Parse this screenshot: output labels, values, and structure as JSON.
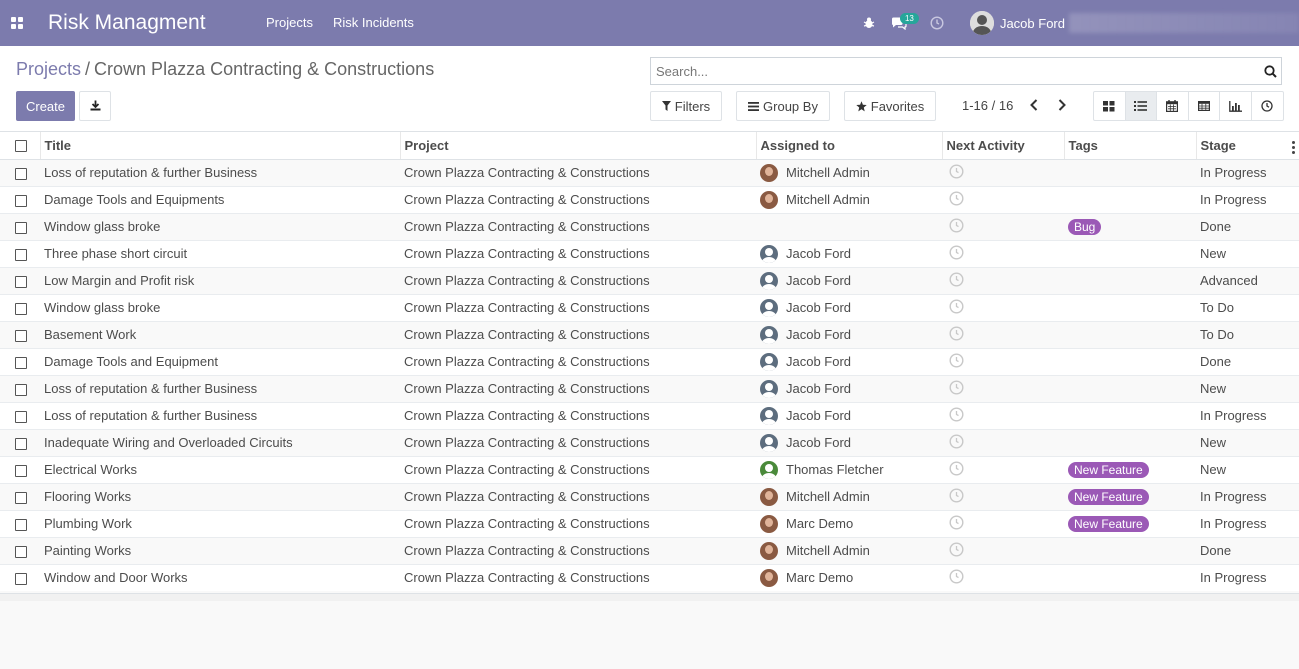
{
  "app": {
    "title": "Risk Managment",
    "menu": [
      "Projects",
      "Risk Incidents"
    ],
    "message_count": "13",
    "user_name": "Jacob Ford"
  },
  "breadcrumb": {
    "parent": "Projects",
    "separator": "/",
    "current": "Crown Plazza Contracting & Constructions"
  },
  "search": {
    "placeholder": "Search..."
  },
  "buttons": {
    "create": "Create",
    "filters": "Filters",
    "group_by": "Group By",
    "favorites": "Favorites"
  },
  "pager": {
    "text": "1-16 / 16"
  },
  "views": [
    "kanban",
    "list",
    "calendar",
    "pivot",
    "graph",
    "activity"
  ],
  "active_view": "list",
  "table": {
    "headers": [
      "Title",
      "Project",
      "Assigned to",
      "Next Activity",
      "Tags",
      "Stage"
    ],
    "rows": [
      {
        "title": "Loss of reputation & further Business",
        "project": "Crown Plazza Contracting & Constructions",
        "assignee": "Mitchell Admin",
        "avatar": "photo",
        "tag": "",
        "stage": "In Progress"
      },
      {
        "title": "Damage Tools and Equipments",
        "project": "Crown Plazza Contracting & Constructions",
        "assignee": "Mitchell Admin",
        "avatar": "photo",
        "tag": "",
        "stage": "In Progress"
      },
      {
        "title": "Window glass broke",
        "project": "Crown Plazza Contracting & Constructions",
        "assignee": "",
        "avatar": "",
        "tag": "Bug",
        "stage": "Done"
      },
      {
        "title": "Three phase short circuit",
        "project": "Crown Plazza Contracting & Constructions",
        "assignee": "Jacob Ford",
        "avatar": "generic",
        "tag": "",
        "stage": "New"
      },
      {
        "title": "Low Margin and Profit risk",
        "project": "Crown Plazza Contracting & Constructions",
        "assignee": "Jacob Ford",
        "avatar": "generic",
        "tag": "",
        "stage": "Advanced"
      },
      {
        "title": "Window glass broke",
        "project": "Crown Plazza Contracting & Constructions",
        "assignee": "Jacob Ford",
        "avatar": "generic",
        "tag": "",
        "stage": "To Do"
      },
      {
        "title": "Basement Work",
        "project": "Crown Plazza Contracting & Constructions",
        "assignee": "Jacob Ford",
        "avatar": "generic",
        "tag": "",
        "stage": "To Do"
      },
      {
        "title": "Damage Tools and Equipment",
        "project": "Crown Plazza Contracting & Constructions",
        "assignee": "Jacob Ford",
        "avatar": "generic",
        "tag": "",
        "stage": "Done"
      },
      {
        "title": "Loss of reputation & further Business",
        "project": "Crown Plazza Contracting & Constructions",
        "assignee": "Jacob Ford",
        "avatar": "generic",
        "tag": "",
        "stage": "New"
      },
      {
        "title": "Loss of reputation & further Business",
        "project": "Crown Plazza Contracting & Constructions",
        "assignee": "Jacob Ford",
        "avatar": "generic",
        "tag": "",
        "stage": "In Progress"
      },
      {
        "title": "Inadequate Wiring and Overloaded Circuits",
        "project": "Crown Plazza Contracting & Constructions",
        "assignee": "Jacob Ford",
        "avatar": "generic",
        "tag": "",
        "stage": "New"
      },
      {
        "title": "Electrical Works",
        "project": "Crown Plazza Contracting & Constructions",
        "assignee": "Thomas Fletcher",
        "avatar": "green",
        "tag": "New Feature",
        "stage": "New"
      },
      {
        "title": "Flooring Works",
        "project": "Crown Plazza Contracting & Constructions",
        "assignee": "Mitchell Admin",
        "avatar": "photo",
        "tag": "New Feature",
        "stage": "In Progress"
      },
      {
        "title": "Plumbing Work",
        "project": "Crown Plazza Contracting & Constructions",
        "assignee": "Marc Demo",
        "avatar": "photo",
        "tag": "New Feature",
        "stage": "In Progress"
      },
      {
        "title": "Painting Works",
        "project": "Crown Plazza Contracting & Constructions",
        "assignee": "Mitchell Admin",
        "avatar": "photo",
        "tag": "",
        "stage": "Done"
      },
      {
        "title": "Window and Door Works",
        "project": "Crown Plazza Contracting & Constructions",
        "assignee": "Marc Demo",
        "avatar": "photo",
        "tag": "",
        "stage": "In Progress"
      }
    ]
  },
  "colors": {
    "brand": "#7c7bad",
    "tag": "#9b59b6",
    "badge": "#26a69a"
  }
}
